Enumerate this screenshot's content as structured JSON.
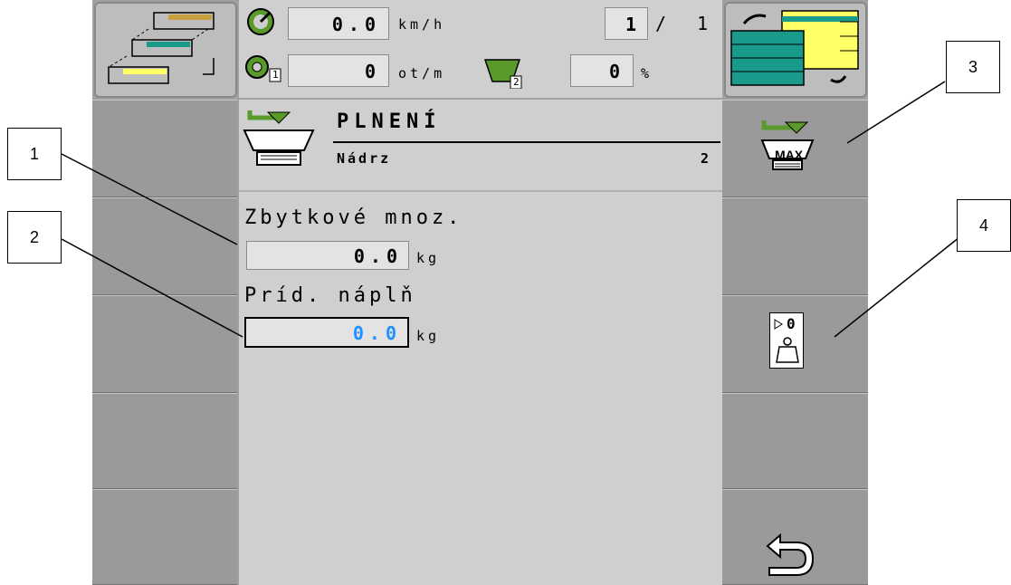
{
  "header": {
    "speed": {
      "value": "0.0",
      "unit": "km/h"
    },
    "rpm": {
      "value": "0",
      "unit": "ot/m",
      "index": "1"
    },
    "tank": {
      "value": "0",
      "unit": "%",
      "index": "2"
    },
    "page": {
      "current": "1",
      "separator": "/",
      "total": "1"
    }
  },
  "panel": {
    "title": "PLNENÍ",
    "subtitle": "Nádrz",
    "tank_number": "2"
  },
  "fields": {
    "residual": {
      "label": "Zbytkové mnoz.",
      "value": "0.0",
      "unit": "kg"
    },
    "added": {
      "label": "Príd. náplň",
      "value": "0.0",
      "unit": "kg"
    }
  },
  "softkeys": {
    "max_label": "MAX",
    "tare_label": "0"
  },
  "callouts": [
    "1",
    "2",
    "3",
    "4"
  ],
  "colors": {
    "screen_bg": "#a0a0a0",
    "panel_bg": "#cfcfcf",
    "accent_green": "#5a9a2a",
    "accent_teal": "#1a9a8a",
    "accent_yellow": "#ffff66",
    "active_value": "#1e90ff"
  }
}
